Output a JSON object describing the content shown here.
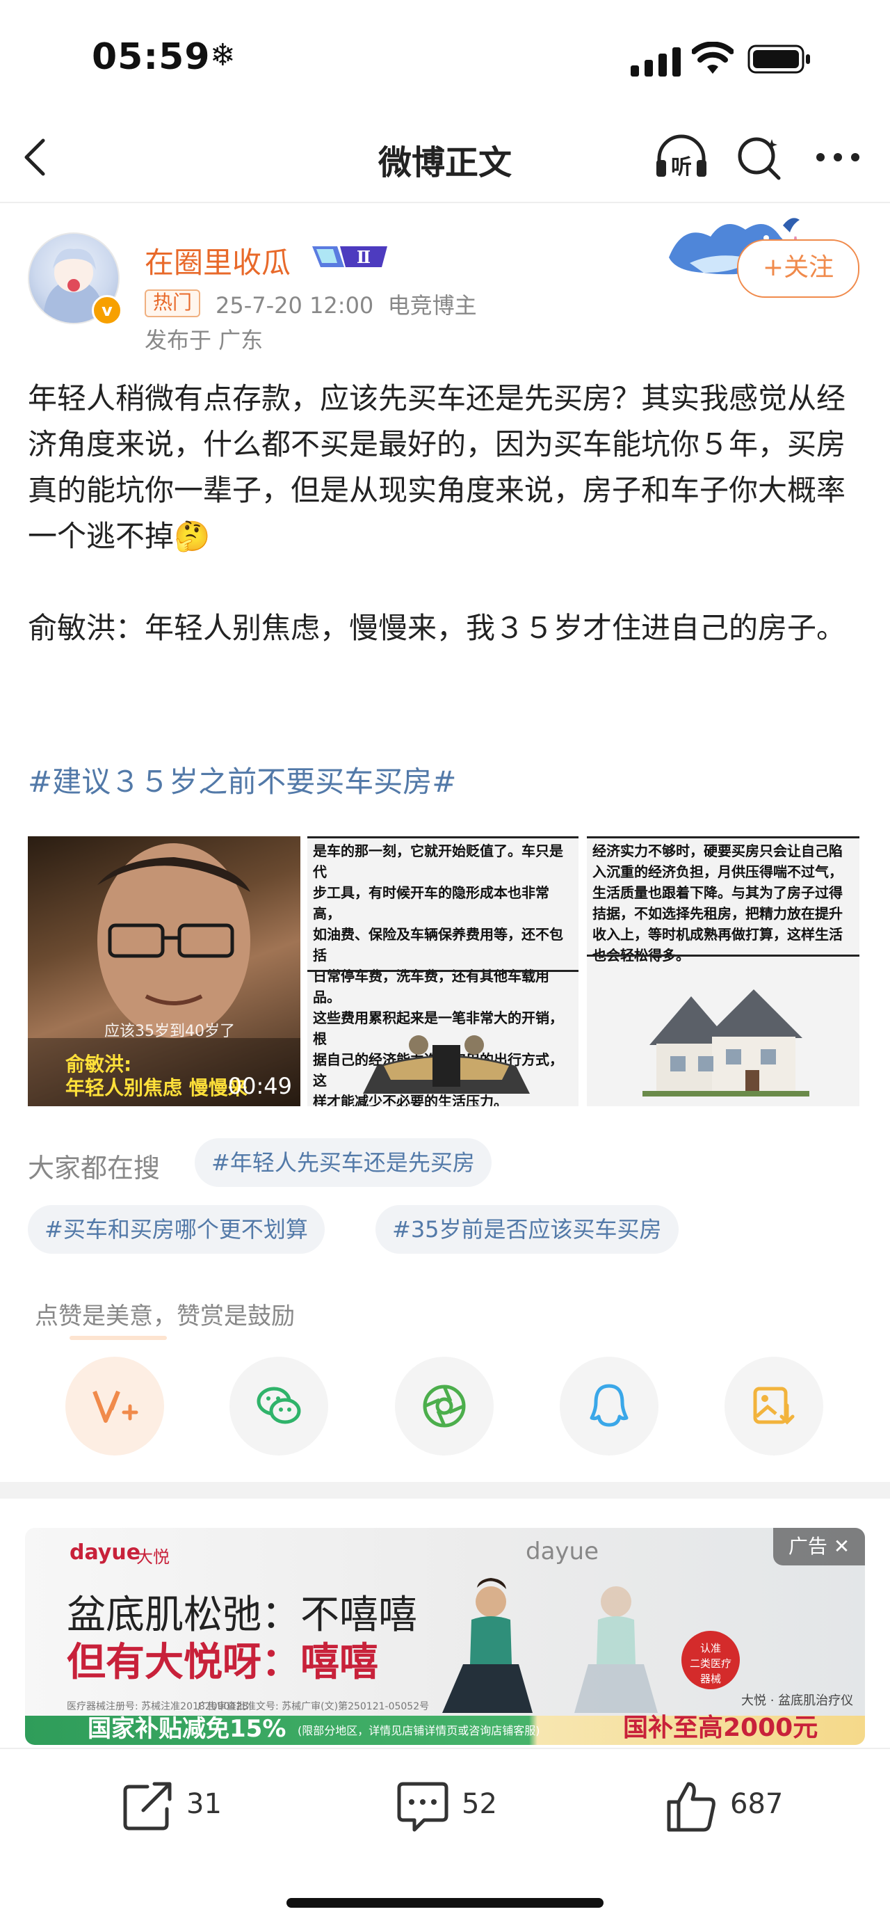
{
  "status_bar": {
    "time": "05:59",
    "extra_icon": "❄"
  },
  "nav": {
    "title": "微博正文",
    "back_icon": "chevron-left-icon",
    "listen_icon": "headphone-listen-icon",
    "listen_label": "听",
    "search_icon": "search-icon",
    "more_icon": "more-icon"
  },
  "author": {
    "name": "在圈里收瓜",
    "badge_level": "Ⅱ",
    "hot_label": "热门",
    "date": "25-7-20 12:00",
    "category": "电竞博主",
    "location": "发布于 广东",
    "follow_label": "+关注",
    "verified_mark": "v"
  },
  "post": {
    "text": "年轻人稍微有点存款，应该先买车还是先买房？其实我感觉从经济角度来说，什么都不买是最好的，因为买车能坑你５年，买房真的能坑你一辈子，但是从现实角度来说，房子和车子你大概率一个逃不掉🤔\n\n俞敏洪：年轻人别焦虑，慢慢来，我３５岁才住进自己的房子。",
    "hashtag": "#建议３５岁之前不要买车买房#"
  },
  "images": {
    "img1": {
      "subtitle_small": "应该35岁到40岁了",
      "subtitle_name": "俞敏洪:",
      "subtitle_main": "年轻人别焦虑 慢慢来",
      "duration": "00:49"
    },
    "img2": {
      "text": "是车的那一刻，它就开始贬值了。车只是代\n步工具，有时候开车的隐形成本也非常高，\n如油费、保险及车辆保养费用等，还不包括\n日常停车费，洗车费，还有其他车载用品。\n这些费用累积起来是一笔非常大的开销，根\n据自己的经济能力选择实用的出行方式，这\n样才能减少不必要的生活压力。"
    },
    "img3": {
      "text": "经济实力不够时，硬要买房只会让自己陷\n入沉重的经济负担，月供压得喘不过气，\n生活质量也跟着下降。与其为了房子过得\n拮据，不如选择先租房，把精力放在提升\n收入上，等时机成熟再做打算，这样生活\n也会轻松得多。"
    }
  },
  "search": {
    "label": "大家都在搜",
    "chips": [
      "#年轻人先买车还是先买房",
      "#买车和买房哪个更不划算",
      "#35岁前是否应该买车买房"
    ]
  },
  "reward": {
    "hint": "点赞是美意，赞赏是鼓励"
  },
  "share_icons": [
    "reward-v-plus-icon",
    "wechat-icon",
    "moments-icon",
    "qq-icon",
    "save-image-icon"
  ],
  "ad": {
    "brand": "dayue",
    "brand_cn": "大悦",
    "brand_center": "dayue",
    "line1": "盆底肌松弛：不嘻嘻",
    "line2": "但有大悦呀：嘻嘻",
    "small1": "医疗器械注册号: 苏械注准20182090428",
    "small2": "广告审查批准文号: 苏械广审(文)第250121-05052号",
    "bottom_left": "国家补贴减免15%",
    "bottom_mid": "(限部分地区，详情见店铺详情页或咨询店铺客服)",
    "bottom_right": "国补至高2000元",
    "badge": "广告 ✕",
    "product": "大悦 · 盆底肌治疗仪",
    "seal": "认准\n二类医疗\n器械"
  },
  "actions": {
    "repost": "31",
    "comment": "52",
    "like": "687"
  },
  "colors": {
    "accent_orange": "#f08a4b",
    "link_blue": "#5279a8",
    "username": "#e8692a"
  }
}
